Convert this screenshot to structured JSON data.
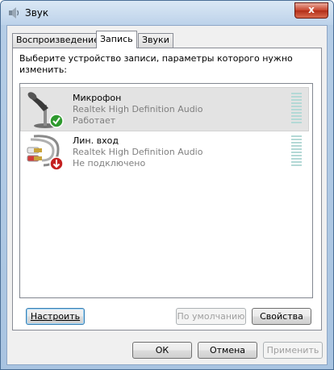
{
  "window": {
    "title": "Звук",
    "close_glyph": "x"
  },
  "tabs": [
    {
      "label": "Воспроизведение",
      "active": false
    },
    {
      "label": "Запись",
      "active": true
    },
    {
      "label": "Звуки",
      "active": false
    }
  ],
  "instruction": "Выберите устройство записи, параметры которого нужно изменить:",
  "devices": [
    {
      "name": "Микрофон",
      "driver": "Realtek High Definition Audio",
      "status": "Работает",
      "icon": "microphone-icon",
      "badge": "green-check-badge",
      "selected": true
    },
    {
      "name": "Лин. вход",
      "driver": "Realtek High Definition Audio",
      "status": "Не подключено",
      "icon": "rca-cable-icon",
      "badge": "red-down-arrow-badge",
      "selected": false
    }
  ],
  "buttons": {
    "configure": "Настроить",
    "default": "По умолчанию",
    "properties": "Свойства",
    "ok": "ОК",
    "cancel": "Отмена",
    "apply": "Применить"
  },
  "colors": {
    "meter": "#b4d9d6",
    "selected_row": "#e3e3e3"
  }
}
